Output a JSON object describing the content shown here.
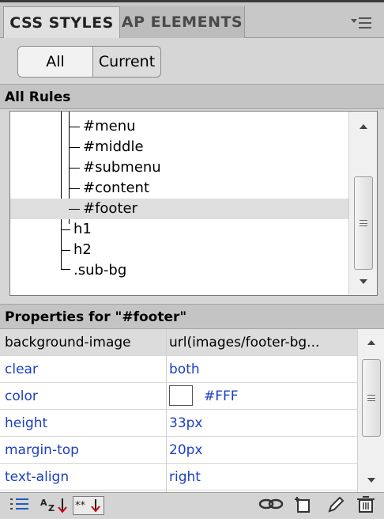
{
  "tabs": [
    {
      "label": "CSS STYLES",
      "active": true
    },
    {
      "label": "AP ELEMENTS",
      "active": false
    }
  ],
  "panel_menu_icon": "panel-menu-icon",
  "view_buttons": {
    "all": "All",
    "current": "Current",
    "selected": "All"
  },
  "all_rules": {
    "header": "All Rules",
    "items": [
      "#menu",
      "#middle",
      "#submenu",
      "#content",
      "#footer",
      "h1",
      "h2",
      ".sub-bg"
    ],
    "selected": "#footer"
  },
  "properties": {
    "header": "Properties for \"#footer\"",
    "rows": [
      {
        "name": "background-image",
        "value": "url(images/footer-bg...",
        "color": "#000000"
      },
      {
        "name": "clear",
        "value": "both",
        "color": "#1b3fbf"
      },
      {
        "name": "color",
        "value": "#FFF",
        "color": "#1b3fbf",
        "swatch": "#FFFFFF"
      },
      {
        "name": "height",
        "value": "33px",
        "color": "#1b3fbf"
      },
      {
        "name": "margin-top",
        "value": "20px",
        "color": "#1b3fbf"
      },
      {
        "name": "text-align",
        "value": "right",
        "color": "#1b3fbf"
      }
    ]
  },
  "toolbar": {
    "left": [
      "category-view-icon",
      "alphabetical-view-icon",
      "set-properties-only-icon"
    ],
    "right": [
      "attach-stylesheet-icon",
      "new-css-rule-icon",
      "edit-rule-icon",
      "delete-rule-icon"
    ]
  }
}
